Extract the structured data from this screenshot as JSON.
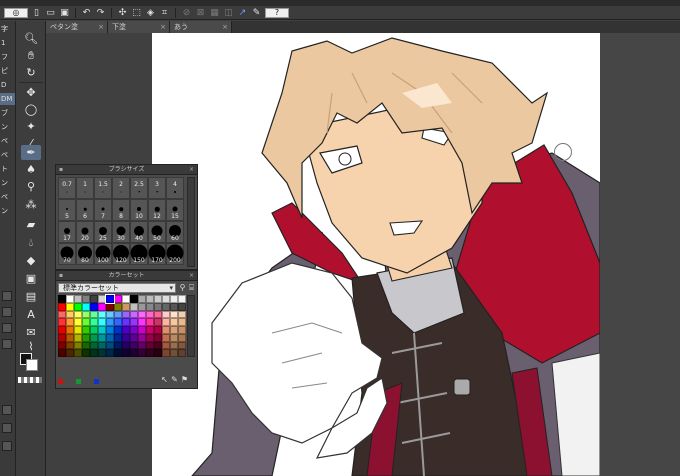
{
  "toolbar": {
    "icons": [
      "logo-icon",
      "new-file-icon",
      "open-icon",
      "save-icon",
      "undo-icon",
      "redo-icon",
      "transform-icon",
      "select-icon",
      "fill-icon",
      "crop-icon",
      "snap-icon",
      "ruler-icon",
      "grid-icon",
      "perspective-icon",
      "pen-pressure-icon",
      "help-icon"
    ],
    "help_label": "?"
  },
  "tabs": [
    {
      "label": "ペタン塗"
    },
    {
      "label": "下塗"
    },
    {
      "label": "あう"
    }
  ],
  "left_panel": {
    "labels": [
      "字",
      "1",
      "フ",
      "ピ",
      "D",
      "DM",
      "ブ",
      "ン",
      "ペ",
      "ペ",
      "ト",
      "ン",
      "ペ",
      "ン"
    ]
  },
  "tools": {
    "icons": [
      "zoom-icon",
      "hand-icon",
      "rotate-icon",
      "move-icon",
      "lasso-icon",
      "select-arrow-icon",
      "eyedropper-icon",
      "pen-icon",
      "brush-icon",
      "airbrush-icon",
      "decoration-icon",
      "eraser-icon",
      "blend-icon",
      "fill-icon",
      "gradient-icon",
      "figure-icon",
      "text-icon",
      "balloon-icon",
      "correct-line-icon"
    ],
    "text_tool_glyph": "A"
  },
  "brush_panel": {
    "title": "ブラシサイズ",
    "rows": [
      [
        "0.7",
        "1",
        "1.5",
        "2",
        "2.5",
        "3",
        "4"
      ],
      [
        "5",
        "6",
        "7",
        "8",
        "10",
        "12",
        "15"
      ],
      [
        "17",
        "20",
        "25",
        "30",
        "40",
        "50",
        "60"
      ],
      [
        "70",
        "80",
        "100",
        "120",
        "150",
        "170",
        "200"
      ]
    ],
    "dot_sizes": [
      [
        1,
        1,
        1,
        1,
        1.5,
        1.5,
        2
      ],
      [
        2,
        2.5,
        3,
        3.5,
        4,
        4.5,
        5
      ],
      [
        6,
        7,
        8,
        9,
        10,
        11,
        12
      ],
      [
        13,
        14,
        15,
        16,
        17,
        17,
        17
      ]
    ]
  },
  "color_panel": {
    "title": "カラーセット",
    "selected_set": "標準カラーセット",
    "selected_index": 6,
    "mini_colors": [
      "#cc1111",
      "#119933",
      "#1133cc"
    ],
    "rows": [
      [
        "#000000",
        "#ffffff",
        "#c0c0c0",
        "#808080",
        "#404040",
        "#d4d4d4",
        "#0000ff",
        "#ff00ff",
        "#ffffff",
        "#000000",
        "#aaaaaa",
        "#bbbbbb",
        "#cccccc",
        "#dddddd",
        "#eeeeee",
        "#f4f4f4"
      ],
      [
        "#ff0000",
        "#ffff00",
        "#00ff00",
        "#00ffff",
        "#0000ff",
        "#ff00ff",
        "#800000",
        "#808000",
        "#cc9966",
        "#c0c0c0",
        "#999999",
        "#888888",
        "#777777",
        "#666666",
        "#555555",
        "#444444"
      ],
      [
        "#ff6666",
        "#ffcc66",
        "#ffff66",
        "#99ff66",
        "#66ff99",
        "#66ffff",
        "#66ccff",
        "#6699ff",
        "#9966ff",
        "#cc66ff",
        "#ff66ff",
        "#ff66cc",
        "#ff6699",
        "#ffcccc",
        "#ffe0cc",
        "#f0d0b0"
      ],
      [
        "#ff3333",
        "#ff9933",
        "#ffff33",
        "#66ff33",
        "#33ff99",
        "#33ffff",
        "#3399ff",
        "#3366ff",
        "#6633ff",
        "#9933ff",
        "#ff33ff",
        "#ff3399",
        "#cc3366",
        "#ffb3a0",
        "#f5c8a0",
        "#e8b890"
      ],
      [
        "#e60000",
        "#e67300",
        "#e6e600",
        "#33cc00",
        "#00cc66",
        "#00cccc",
        "#0080e6",
        "#0033cc",
        "#4d00cc",
        "#8000cc",
        "#cc00cc",
        "#cc0066",
        "#b30047",
        "#e09070",
        "#d8a07a",
        "#c98f6a"
      ],
      [
        "#b30000",
        "#b35900",
        "#b3b300",
        "#269900",
        "#00994d",
        "#009999",
        "#0066b3",
        "#002699",
        "#390099",
        "#600099",
        "#990099",
        "#99004d",
        "#800033",
        "#c07050",
        "#b88a66",
        "#a87855"
      ],
      [
        "#800000",
        "#804000",
        "#808000",
        "#1a6600",
        "#006633",
        "#006666",
        "#004d80",
        "#001a66",
        "#260066",
        "#400066",
        "#660066",
        "#660033",
        "#4d001f",
        "#a05a40",
        "#987050",
        "#805a40"
      ],
      [
        "#4d0000",
        "#4d2600",
        "#4d4d00",
        "#0d3300",
        "#00331a",
        "#003333",
        "#00264d",
        "#000d33",
        "#130033",
        "#200033",
        "#330033",
        "#33001a",
        "#26000f",
        "#804530",
        "#705038",
        "#604030"
      ]
    ]
  }
}
